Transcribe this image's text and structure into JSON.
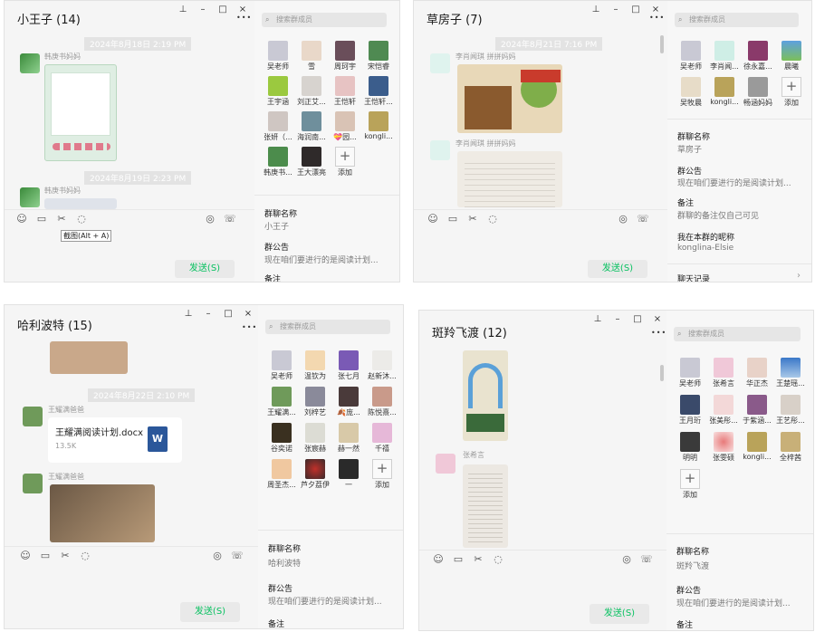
{
  "icons": {
    "pin": "⊥",
    "minimize": "–",
    "maximize": "□",
    "close": "×",
    "more": "•••",
    "search": "⌕",
    "emoji": "☺",
    "folder": "▭",
    "scissors": "✂",
    "chat": "◌",
    "video": "◎",
    "phone": "☏",
    "add": "+",
    "chevron": "›"
  },
  "colors": {
    "send_text": "#07c160",
    "word_icon": "#2b579a"
  },
  "windows": [
    {
      "id": "w1",
      "title": "小王子 (14)",
      "timestamps": [
        "2024年8月18日 2:19 PM",
        "2024年8月19日 2:23 PM"
      ],
      "senders": [
        "韩庚书妈妈",
        "韩庚书妈妈"
      ],
      "tooltip": "截图(Alt + A)",
      "send_label": "发送(S)",
      "search_placeholder": "搜索群成员",
      "members": [
        "吴老师",
        "雪",
        "周珂宇",
        "宋恺睿",
        "王宇涵",
        "刘正艾...",
        "王恺轩",
        "王恺轩...",
        "张妍（...",
        "海润南...",
        "💝园...",
        "kongli...",
        "韩庚书...",
        "王大漂亮",
        "添加"
      ],
      "info": [
        {
          "label": "群聊名称",
          "value": "小王子"
        },
        {
          "label": "群公告",
          "value": "现在咱们要进行的是阅读计划..."
        },
        {
          "label": "备注",
          "value": ""
        }
      ]
    },
    {
      "id": "w2",
      "title": "草房子 (7)",
      "timestamps": [
        "2024年8月21日 7:16 PM"
      ],
      "senders": [
        "李肖闻琪 拼拼妈妈",
        "李肖闻琪 拼拼妈妈"
      ],
      "send_label": "发送(S)",
      "search_placeholder": "搜索群成员",
      "members": [
        "吴老师",
        "李肖闻...",
        "徐永嘉...",
        "晨曦",
        "吴牧晨",
        "kongli...",
        "畅涵妈妈",
        "添加"
      ],
      "info": [
        {
          "label": "群聊名称",
          "value": "草房子"
        },
        {
          "label": "群公告",
          "value": "现在咱们要进行的是阅读计划..."
        },
        {
          "label": "备注",
          "value": "群聊的备注仅自己可见"
        },
        {
          "label": "我在本群的昵称",
          "value": "konglina-Elsie"
        },
        {
          "label": "聊天记录",
          "value": ""
        }
      ]
    },
    {
      "id": "w3",
      "title": "哈利波特 (15)",
      "timestamps": [
        "2024年8月22日 2:10 PM"
      ],
      "senders": [
        "王耀满爸爸",
        "王耀满爸爸"
      ],
      "file": {
        "name": "王耀满阅读计划.docx",
        "size": "13.5K",
        "icon_letter": "W"
      },
      "send_label": "发送(S)",
      "search_placeholder": "搜索群成员",
      "members": [
        "吴老师",
        "温钦为",
        "张七月",
        "赵新沐...",
        "王耀满...",
        "刘梓艺",
        "🍂庞...",
        "陈悦熹...",
        "谷奕诺",
        "张宸赫",
        "赫一然",
        "千禧",
        "周圣杰...",
        "芦夕荔伊",
        "一",
        "添加"
      ],
      "info": [
        {
          "label": "群聊名称",
          "value": "哈利波特"
        },
        {
          "label": "群公告",
          "value": "现在咱们要进行的是阅读计划..."
        },
        {
          "label": "备注",
          "value": ""
        }
      ]
    },
    {
      "id": "w4",
      "title": "斑羚飞渡 (12)",
      "senders": [
        "张希言"
      ],
      "send_label": "发送(S)",
      "search_placeholder": "搜索群成员",
      "members": [
        "吴老师",
        "张希言",
        "华正杰",
        "王楚瑶...",
        "王月珩",
        "张美彤...",
        "于紫涵...",
        "王艺彤...",
        "明明",
        "张雯硕",
        "kongli...",
        "全梓茜",
        "添加"
      ],
      "info": [
        {
          "label": "群聊名称",
          "value": "斑羚飞渡"
        },
        {
          "label": "群公告",
          "value": "现在咱们要进行的是阅读计划..."
        },
        {
          "label": "备注",
          "value": ""
        }
      ]
    }
  ]
}
